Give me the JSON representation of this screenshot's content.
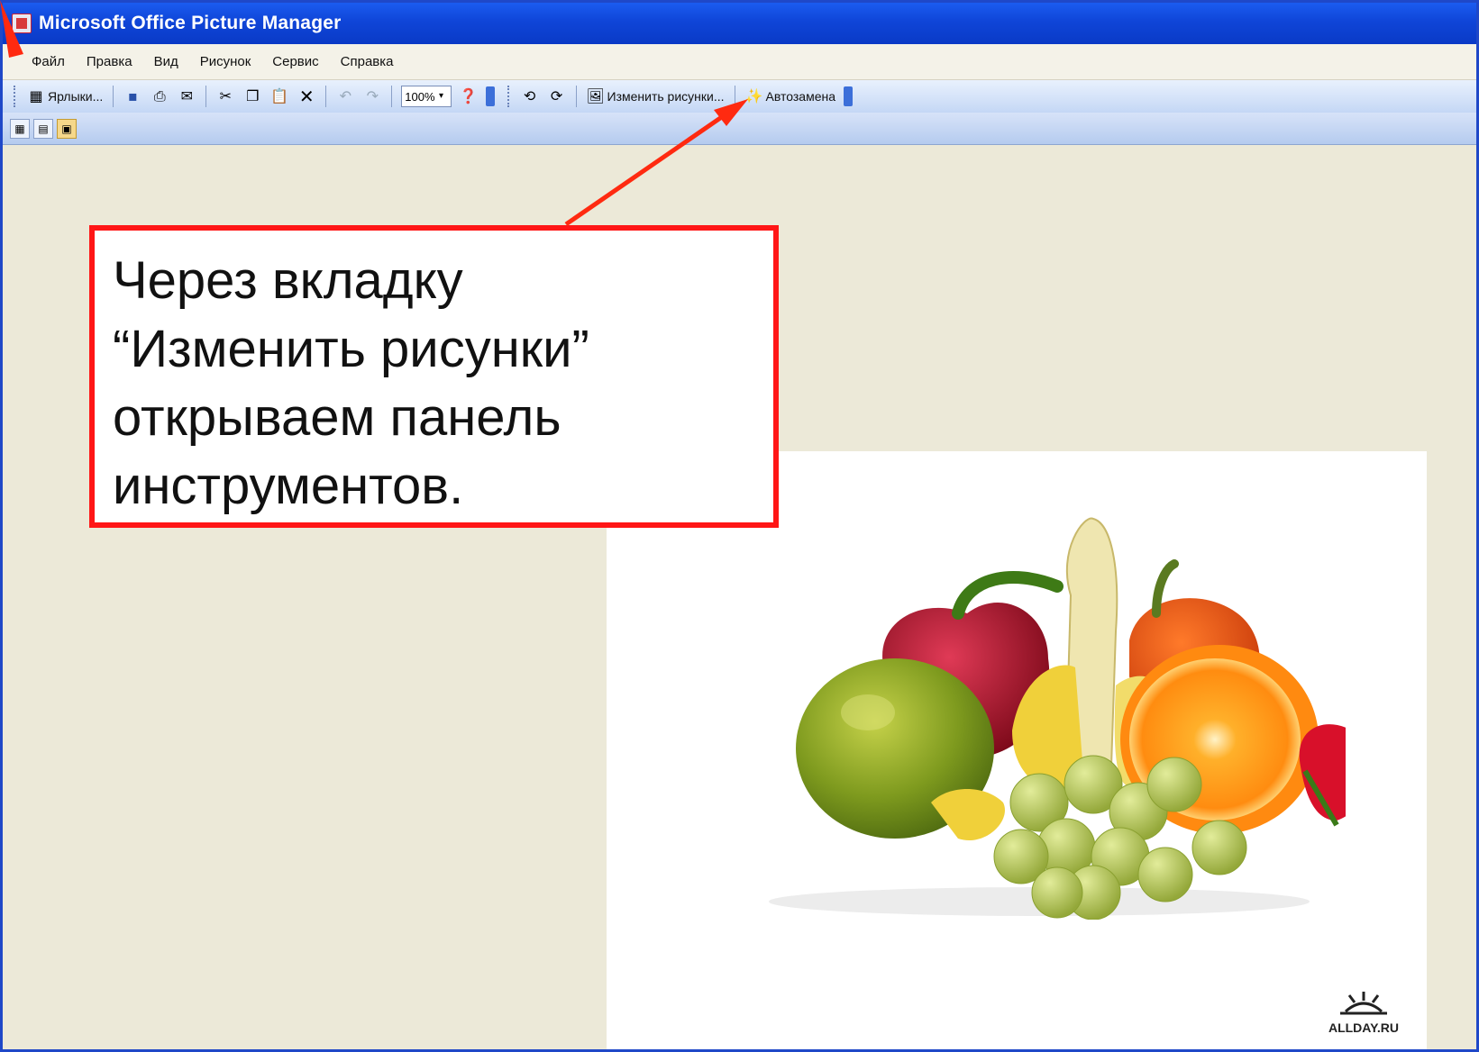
{
  "window": {
    "title": "Microsoft Office Picture Manager"
  },
  "menu": [
    "Файл",
    "Правка",
    "Вид",
    "Рисунок",
    "Сервис",
    "Справка"
  ],
  "toolbar": {
    "shortcuts_label": "Ярлыки...",
    "zoom_value": "100%",
    "edit_pictures_label": "Изменить рисунки...",
    "autocorrect_label": "Автозамена"
  },
  "callout": {
    "lines": [
      "Через вкладку",
      "“Изменить  рисунки”",
      "открываем панель",
      "инструментов."
    ]
  },
  "watermark": {
    "text": "ALLDAY.RU"
  },
  "colors": {
    "titlebar": "#0f45d8",
    "callout_border": "#ff1616",
    "arrow": "#ff2a10",
    "canvas": "#ece9d8"
  }
}
